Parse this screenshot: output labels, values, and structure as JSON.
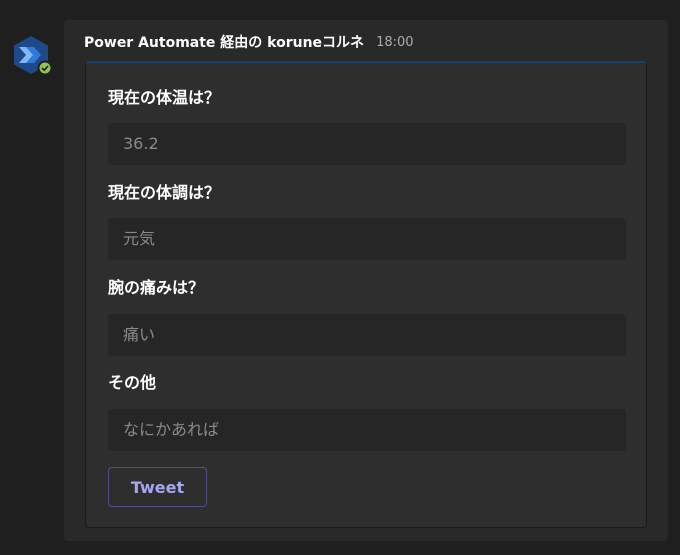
{
  "message": {
    "sender": "Power Automate 経由の koruneコルネ",
    "time": "18:00"
  },
  "colors": {
    "avatar_bg": "#1e4a8c",
    "status_online": "#92c353",
    "button_text": "#a6a7ef"
  },
  "icons": {
    "avatar": "power-automate-icon",
    "status": "checkmark-icon"
  },
  "form": {
    "fields": [
      {
        "label": "現在の体温は？",
        "placeholder": "36.2"
      },
      {
        "label": "現在の体調は？",
        "placeholder": "元気"
      },
      {
        "label": "腕の痛みは？",
        "placeholder": "痛い"
      },
      {
        "label": "その他",
        "placeholder": "なにかあれば"
      }
    ],
    "submit_label": "Tweet"
  }
}
